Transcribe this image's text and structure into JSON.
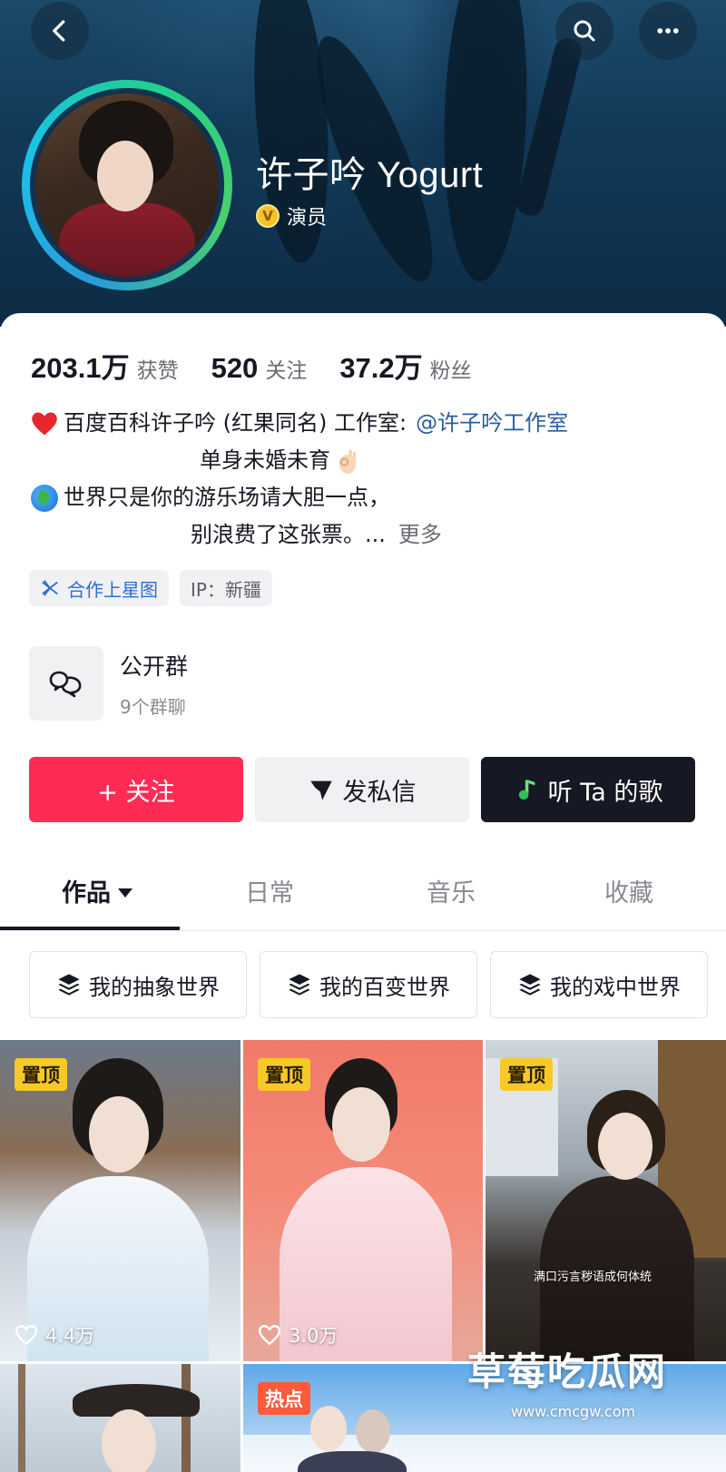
{
  "header": {
    "profile_name": "许子吟 Yogurt",
    "verified_label": "演员",
    "verified_badge": "V",
    "icons": {
      "back": "chevron-left-icon",
      "search": "search-icon",
      "more": "more-dots-icon"
    }
  },
  "stats": [
    {
      "value": "203.1万",
      "label": "获赞"
    },
    {
      "value": "520",
      "label": "关注"
    },
    {
      "value": "37.2万",
      "label": "粉丝"
    }
  ],
  "bio": {
    "line1_text": "百度百科许子吟 (红果同名) 工作室:",
    "line1_mention": "@许子吟工作室",
    "line2_text": "单身未婚未育",
    "line3_text": "世界只是你的游乐场请大胆一点，",
    "line4_text": "别浪费了这张票。...",
    "more_label": "更多"
  },
  "tags": {
    "star_label": "合作上星图",
    "ip_label": "IP：新疆"
  },
  "group": {
    "title": "公开群",
    "subtitle": "9个群聊"
  },
  "actions": {
    "follow_label": "+ 关注",
    "message_label": "发私信",
    "song_label": "听 Ta 的歌"
  },
  "tabs": [
    {
      "label": "作品",
      "active": true
    },
    {
      "label": "日常",
      "active": false
    },
    {
      "label": "音乐",
      "active": false
    },
    {
      "label": "收藏",
      "active": false
    }
  ],
  "collections": [
    {
      "label": "我的抽象世界"
    },
    {
      "label": "我的百变世界"
    },
    {
      "label": "我的戏中世界"
    }
  ],
  "videos": [
    {
      "badge": "置顶",
      "likes": "4.4万",
      "caption": ""
    },
    {
      "badge": "置顶",
      "likes": "3.0万",
      "caption": ""
    },
    {
      "badge": "置顶",
      "likes": "",
      "caption": "满口污言秽语成何体统"
    },
    {
      "badge": "",
      "likes": "",
      "caption": ""
    },
    {
      "badge": "热点",
      "likes": "",
      "caption": ""
    }
  ],
  "watermark": {
    "title": "草莓吃瓜网",
    "url": "www.cmcgw.com"
  },
  "colors": {
    "accent": "#fe2c55",
    "mention": "#2a5d9f",
    "pin_badge": "#f7c928",
    "hot_badge": "#ff5b3a",
    "dark_button": "#161823"
  }
}
